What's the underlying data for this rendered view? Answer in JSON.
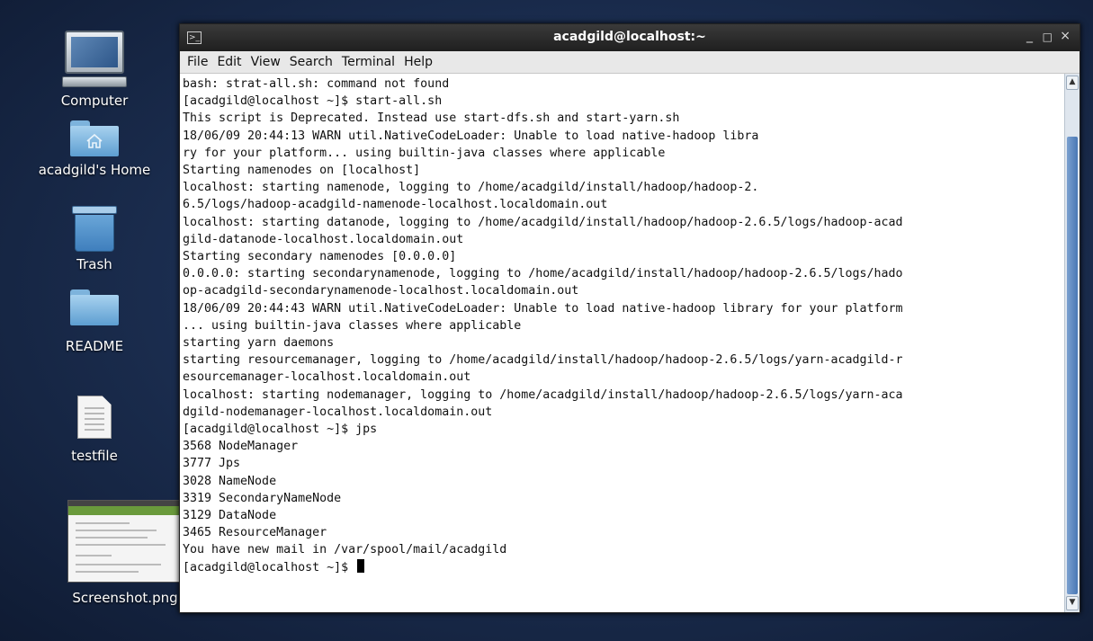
{
  "desktop": {
    "icons": [
      {
        "label": "Computer"
      },
      {
        "label": "acadgild's Home"
      },
      {
        "label": "Trash"
      },
      {
        "label": "README"
      },
      {
        "label": "testfile"
      },
      {
        "label": "Screenshot.png"
      }
    ]
  },
  "window": {
    "title": "acadgild@localhost:~",
    "minimize": "_",
    "maximize": "□",
    "close": "×",
    "menu": [
      "File",
      "Edit",
      "View",
      "Search",
      "Terminal",
      "Help"
    ]
  },
  "terminal": {
    "lines": [
      "bash: strat-all.sh: command not found",
      "[acadgild@localhost ~]$ start-all.sh",
      "This script is Deprecated. Instead use start-dfs.sh and start-yarn.sh",
      "18/06/09 20:44:13 WARN util.NativeCodeLoader: Unable to load native-hadoop libra",
      "ry for your platform... using builtin-java classes where applicable",
      "Starting namenodes on [localhost]",
      "localhost: starting namenode, logging to /home/acadgild/install/hadoop/hadoop-2.",
      "6.5/logs/hadoop-acadgild-namenode-localhost.localdomain.out",
      "localhost: starting datanode, logging to /home/acadgild/install/hadoop/hadoop-2.6.5/logs/hadoop-acad",
      "gild-datanode-localhost.localdomain.out",
      "Starting secondary namenodes [0.0.0.0]",
      "0.0.0.0: starting secondarynamenode, logging to /home/acadgild/install/hadoop/hadoop-2.6.5/logs/hado",
      "op-acadgild-secondarynamenode-localhost.localdomain.out",
      "18/06/09 20:44:43 WARN util.NativeCodeLoader: Unable to load native-hadoop library for your platform",
      "... using builtin-java classes where applicable",
      "starting yarn daemons",
      "starting resourcemanager, logging to /home/acadgild/install/hadoop/hadoop-2.6.5/logs/yarn-acadgild-r",
      "esourcemanager-localhost.localdomain.out",
      "localhost: starting nodemanager, logging to /home/acadgild/install/hadoop/hadoop-2.6.5/logs/yarn-aca",
      "dgild-nodemanager-localhost.localdomain.out",
      "[acadgild@localhost ~]$ jps",
      "3568 NodeManager",
      "3777 Jps",
      "3028 NameNode",
      "3319 SecondaryNameNode",
      "3129 DataNode",
      "3465 ResourceManager",
      "You have new mail in /var/spool/mail/acadgild"
    ],
    "prompt": "[acadgild@localhost ~]$ "
  }
}
